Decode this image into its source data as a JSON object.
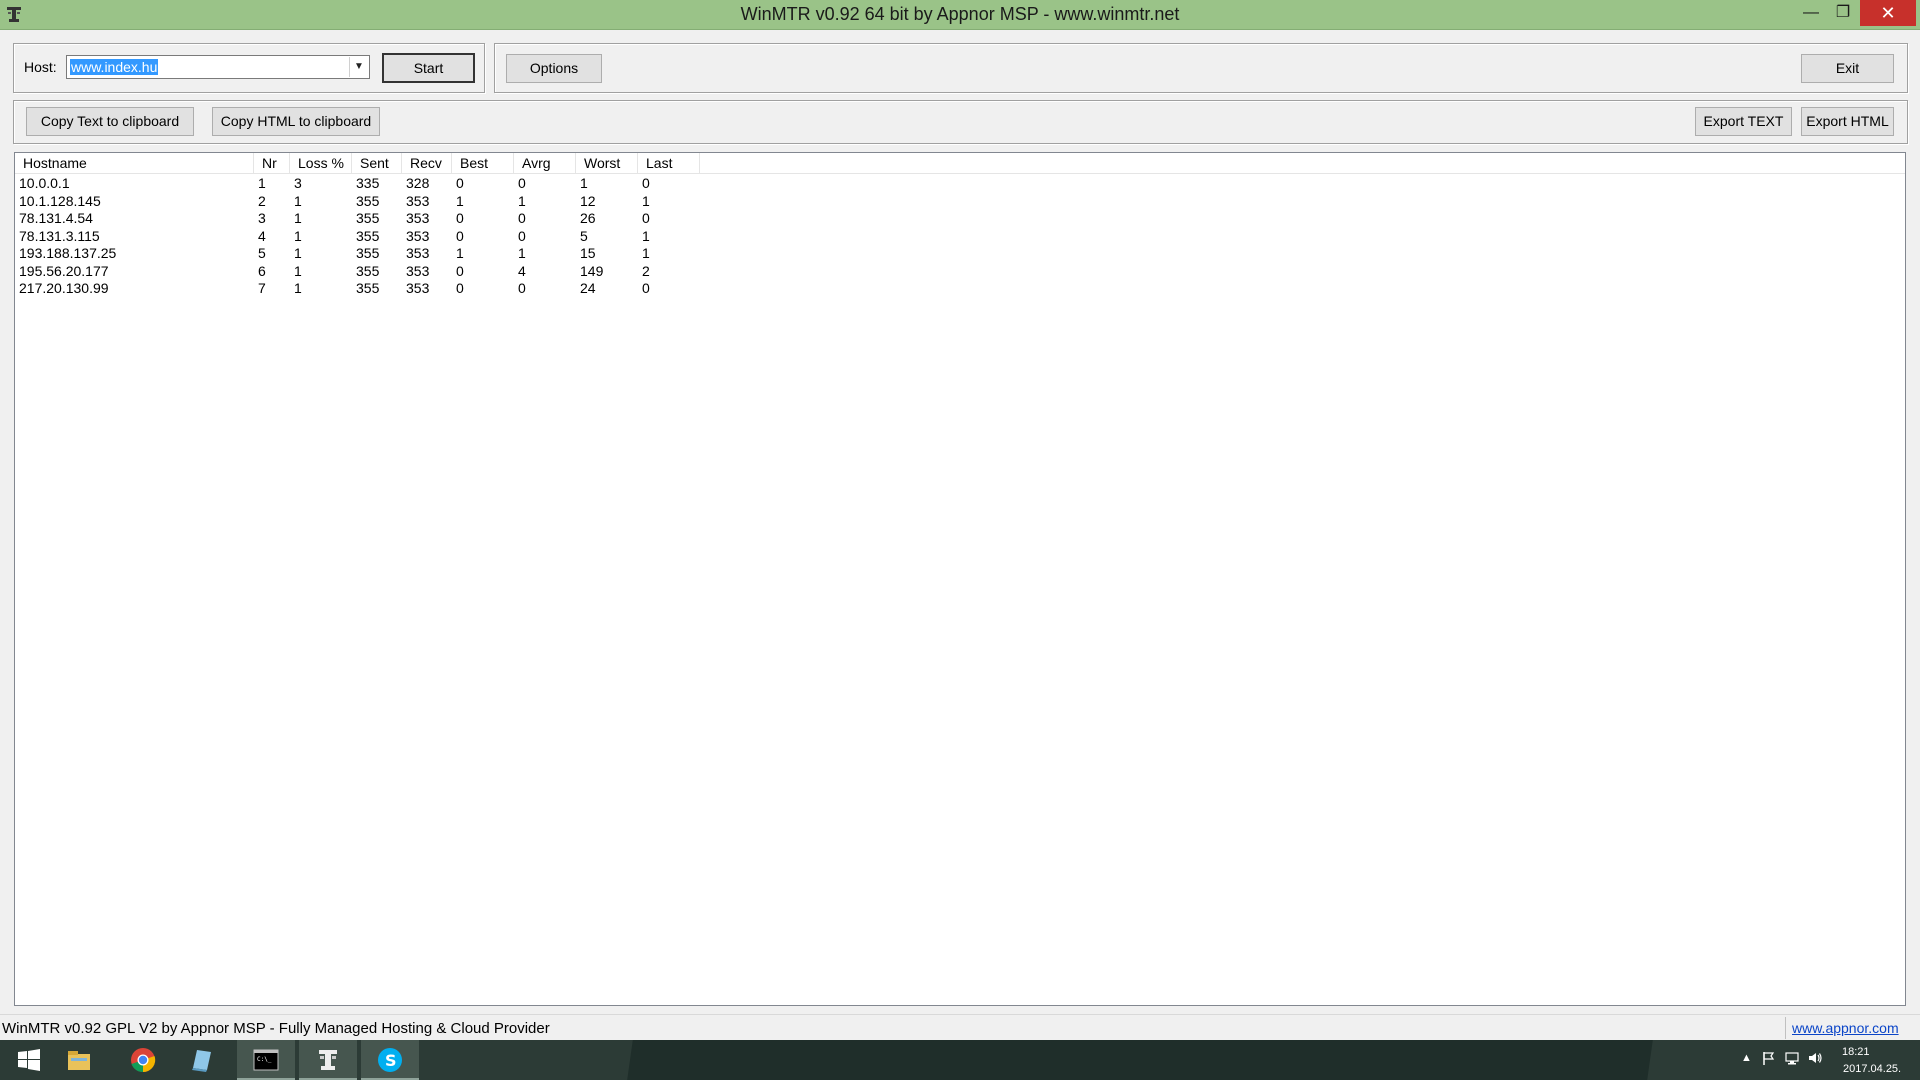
{
  "window": {
    "title": "WinMTR v0.92 64 bit by Appnor MSP - www.winmtr.net",
    "minimize": "—",
    "restore": "❐",
    "close": "✕"
  },
  "host": {
    "label": "Host:",
    "value": "www.index.hu"
  },
  "buttons": {
    "start": "Start",
    "options": "Options",
    "exit": "Exit",
    "copy_text": "Copy Text to clipboard",
    "copy_html": "Copy HTML to clipboard",
    "export_text": "Export TEXT",
    "export_html": "Export HTML"
  },
  "table": {
    "columns": [
      "Hostname",
      "Nr",
      "Loss %",
      "Sent",
      "Recv",
      "Best",
      "Avrg",
      "Worst",
      "Last"
    ],
    "rows": [
      [
        "10.0.0.1",
        "1",
        "3",
        "335",
        "328",
        "0",
        "0",
        "1",
        "0"
      ],
      [
        "10.1.128.145",
        "2",
        "1",
        "355",
        "353",
        "1",
        "1",
        "12",
        "1"
      ],
      [
        "78.131.4.54",
        "3",
        "1",
        "355",
        "353",
        "0",
        "0",
        "26",
        "0"
      ],
      [
        "78.131.3.115",
        "4",
        "1",
        "355",
        "353",
        "0",
        "0",
        "5",
        "1"
      ],
      [
        "193.188.137.25",
        "5",
        "1",
        "355",
        "353",
        "1",
        "1",
        "15",
        "1"
      ],
      [
        "195.56.20.177",
        "6",
        "1",
        "355",
        "353",
        "0",
        "4",
        "149",
        "2"
      ],
      [
        "217.20.130.99",
        "7",
        "1",
        "355",
        "353",
        "0",
        "0",
        "24",
        "0"
      ]
    ]
  },
  "statusbar": {
    "text": "WinMTR v0.92 GPL V2 by Appnor MSP - Fully Managed Hosting & Cloud Provider",
    "link": "www.appnor.com"
  },
  "taskbar": {
    "items": [
      "start-windows-icon",
      "file-explorer-icon",
      "chrome-icon",
      "notepad-icon",
      "command-prompt-icon",
      "winmtr-icon",
      "skype-icon"
    ],
    "tray_up": "▲",
    "time": "18:21",
    "date": "2017.04.25."
  }
}
